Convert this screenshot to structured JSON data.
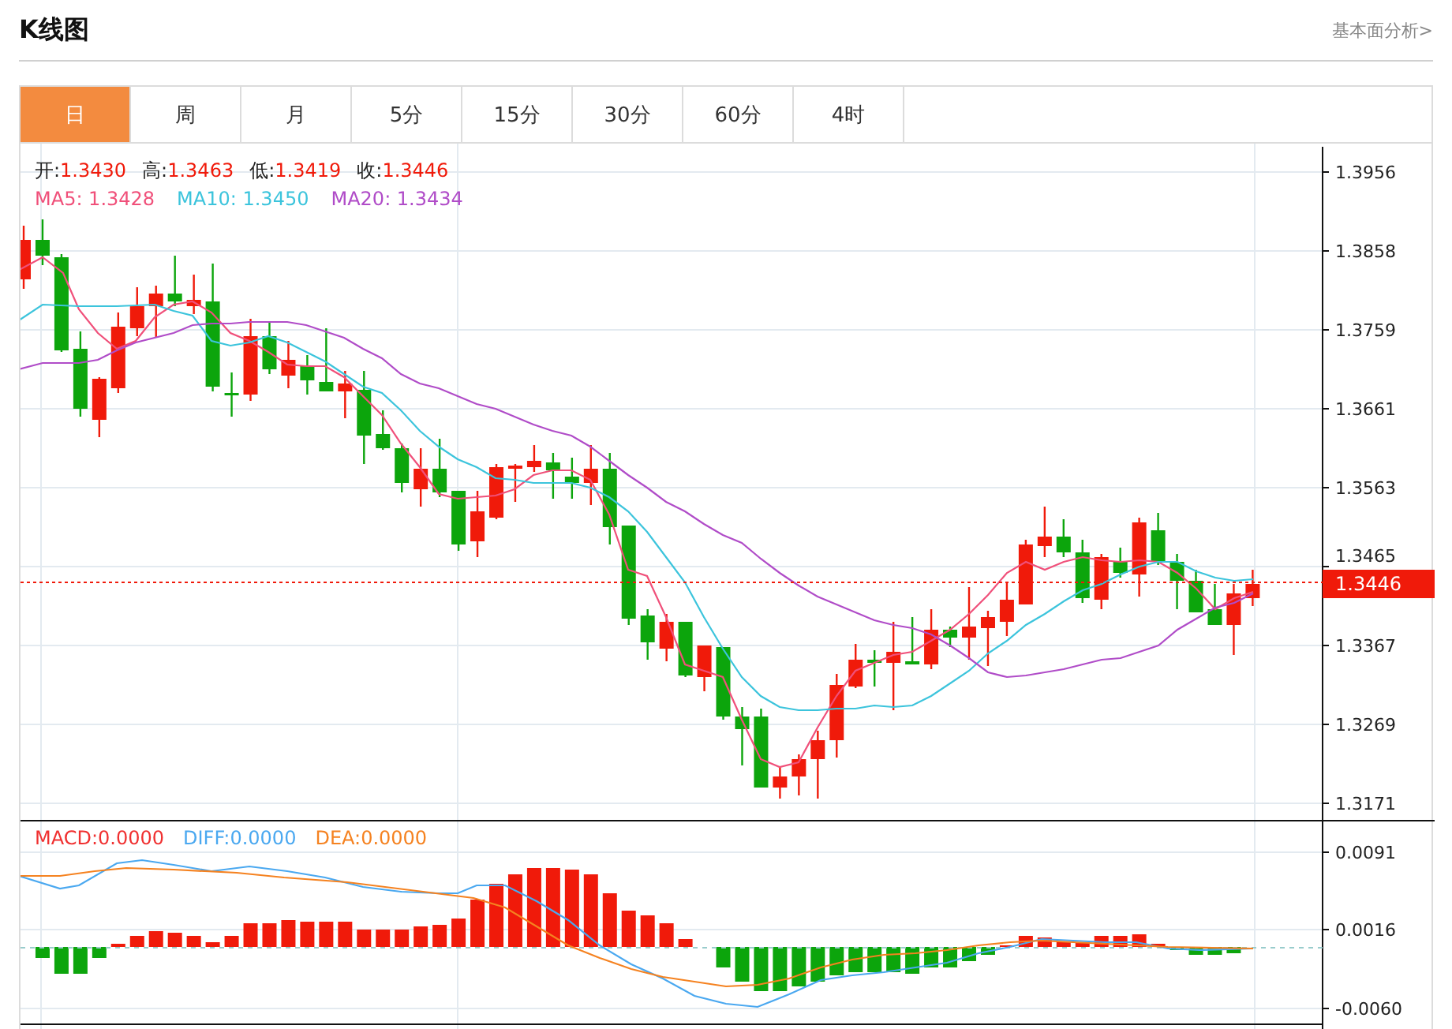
{
  "header": {
    "title": "K线图",
    "link": "基本面分析>"
  },
  "tabs": [
    {
      "label": "日",
      "selected": true
    },
    {
      "label": "周",
      "selected": false
    },
    {
      "label": "月",
      "selected": false
    },
    {
      "label": "5分",
      "selected": false
    },
    {
      "label": "15分",
      "selected": false
    },
    {
      "label": "30分",
      "selected": false
    },
    {
      "label": "60分",
      "selected": false
    },
    {
      "label": "4时",
      "selected": false
    }
  ],
  "price_legend": [
    {
      "label": "开:",
      "value": "1.3430"
    },
    {
      "label": "高:",
      "value": "1.3463"
    },
    {
      "label": "低:",
      "value": "1.3419"
    },
    {
      "label": "收:",
      "value": "1.3446"
    }
  ],
  "ma_legend": [
    {
      "text": "MA5: 1.3428",
      "color": "#f0507a"
    },
    {
      "text": "MA10: 1.3450",
      "color": "#3cc4dc"
    },
    {
      "text": "MA20: 1.3434",
      "color": "#b04cc8"
    }
  ],
  "price_axis": [
    "1.3956",
    "1.3858",
    "1.3759",
    "1.3661",
    "1.3563",
    "1.3465",
    "1.3367",
    "1.3269",
    "1.3171"
  ],
  "current_price": "1.3446",
  "macd_legend": [
    {
      "text": "MACD:0.0000",
      "color": "#f03030"
    },
    {
      "text": "DIFF:0.0000",
      "color": "#4aa8f0"
    },
    {
      "text": "DEA:0.0000",
      "color": "#f58220"
    }
  ],
  "macd_axis": [
    "0.0091",
    "0.0016",
    "-0.0060"
  ]
}
